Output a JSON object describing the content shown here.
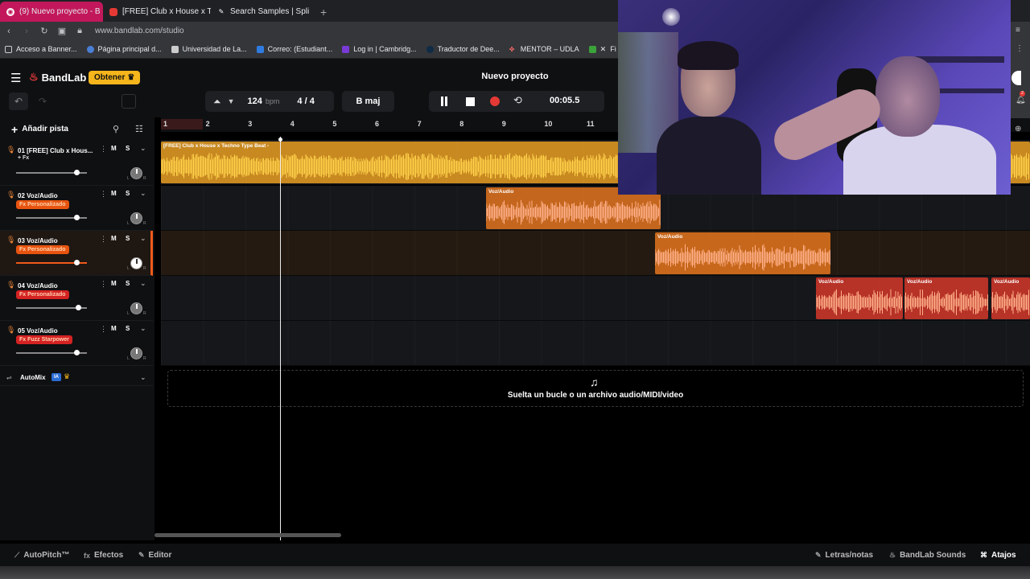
{
  "browser": {
    "tabs": [
      {
        "title": "(9) Nuevo proyecto - B",
        "active": true
      },
      {
        "title": "[FREE] Club x House x Te"
      },
      {
        "title": "Search Samples | Splice"
      }
    ],
    "new_tab": "+",
    "url": "www.bandlab.com/studio",
    "bookmarks": [
      {
        "label": "Acceso a Banner..."
      },
      {
        "label": "Página principal d..."
      },
      {
        "label": "Universidad de La..."
      },
      {
        "label": "Correo: (Estudiant..."
      },
      {
        "label": "Log in | Cambridg..."
      },
      {
        "label": "Traductor de Dee..."
      },
      {
        "label": "MENTOR – UDLA"
      },
      {
        "label": "Fi"
      }
    ]
  },
  "header": {
    "brand": "BandLab",
    "get_button": "Obtener",
    "project_title": "Nuevo proyecto"
  },
  "toolbar": {
    "bpm": "124",
    "bpm_unit": "bpm",
    "time_signature": "4 / 4",
    "key": "B maj",
    "time": "00:05.5"
  },
  "tracks_panel": {
    "add_track": "Añadir pista",
    "tracks": [
      {
        "name": "01  [FREE] Club x Hous...",
        "fx": "+ Fx",
        "fx_style": "plain",
        "volume": 0.85,
        "mute": "M",
        "solo": "S"
      },
      {
        "name": "02  Voz/Audio",
        "fx": "Fx  Personalizado",
        "fx_style": "orange",
        "volume": 0.85,
        "mute": "M",
        "solo": "S"
      },
      {
        "name": "03  Voz/Audio",
        "fx": "Fx  Personalizado",
        "fx_style": "orange",
        "volume": 0.85,
        "mute": "M",
        "solo": "S",
        "selected": true
      },
      {
        "name": "04  Voz/Audio",
        "fx": "Fx  Personalizado",
        "fx_style": "red",
        "volume": 0.87,
        "mute": "M",
        "solo": "S"
      },
      {
        "name": "05  Voz/Audio",
        "fx": "Fx  Fuzz Starpower",
        "fx_style": "red",
        "volume": 0.85,
        "mute": "M",
        "solo": "S"
      }
    ],
    "pan_left": "L",
    "pan_right": "R",
    "automix": "AutoMix",
    "ia_badge": "IA"
  },
  "timeline": {
    "bars": [
      "1",
      "2",
      "3",
      "4",
      "5",
      "6",
      "7",
      "8",
      "9",
      "10",
      "11"
    ],
    "clips": [
      {
        "label": "[FREE] Club x House x Techno Type Beat -",
        "track": 0,
        "color": "#f5a623"
      },
      {
        "label": "Voz/Audio",
        "track": 1,
        "color": "#f07a1e"
      },
      {
        "label": "Voz/Audio",
        "track": 2,
        "color": "#f07a1e"
      },
      {
        "label": "Voz/Audio",
        "track": 3,
        "color": "#e03a2a"
      },
      {
        "label": "Voz/Audio",
        "track": 3,
        "color": "#e03a2a"
      },
      {
        "label": "Voz/Audio",
        "track": 3,
        "color": "#e03a2a"
      }
    ],
    "drop_text": "Suelta un bucle o un archivo audio/MIDI/video"
  },
  "footer": {
    "autopitch": "AutoPitch™",
    "effects": "Efectos",
    "editor": "Editor",
    "lyrics": "Letras/notas",
    "sounds": "BandLab Sounds",
    "shortcuts": "Atajos"
  },
  "colors": {
    "accent": "#f5b51b",
    "track1": "#f5a623",
    "vocal_orange": "#f07a1e",
    "vocal_red": "#e03a2a",
    "record": "#e53935"
  }
}
